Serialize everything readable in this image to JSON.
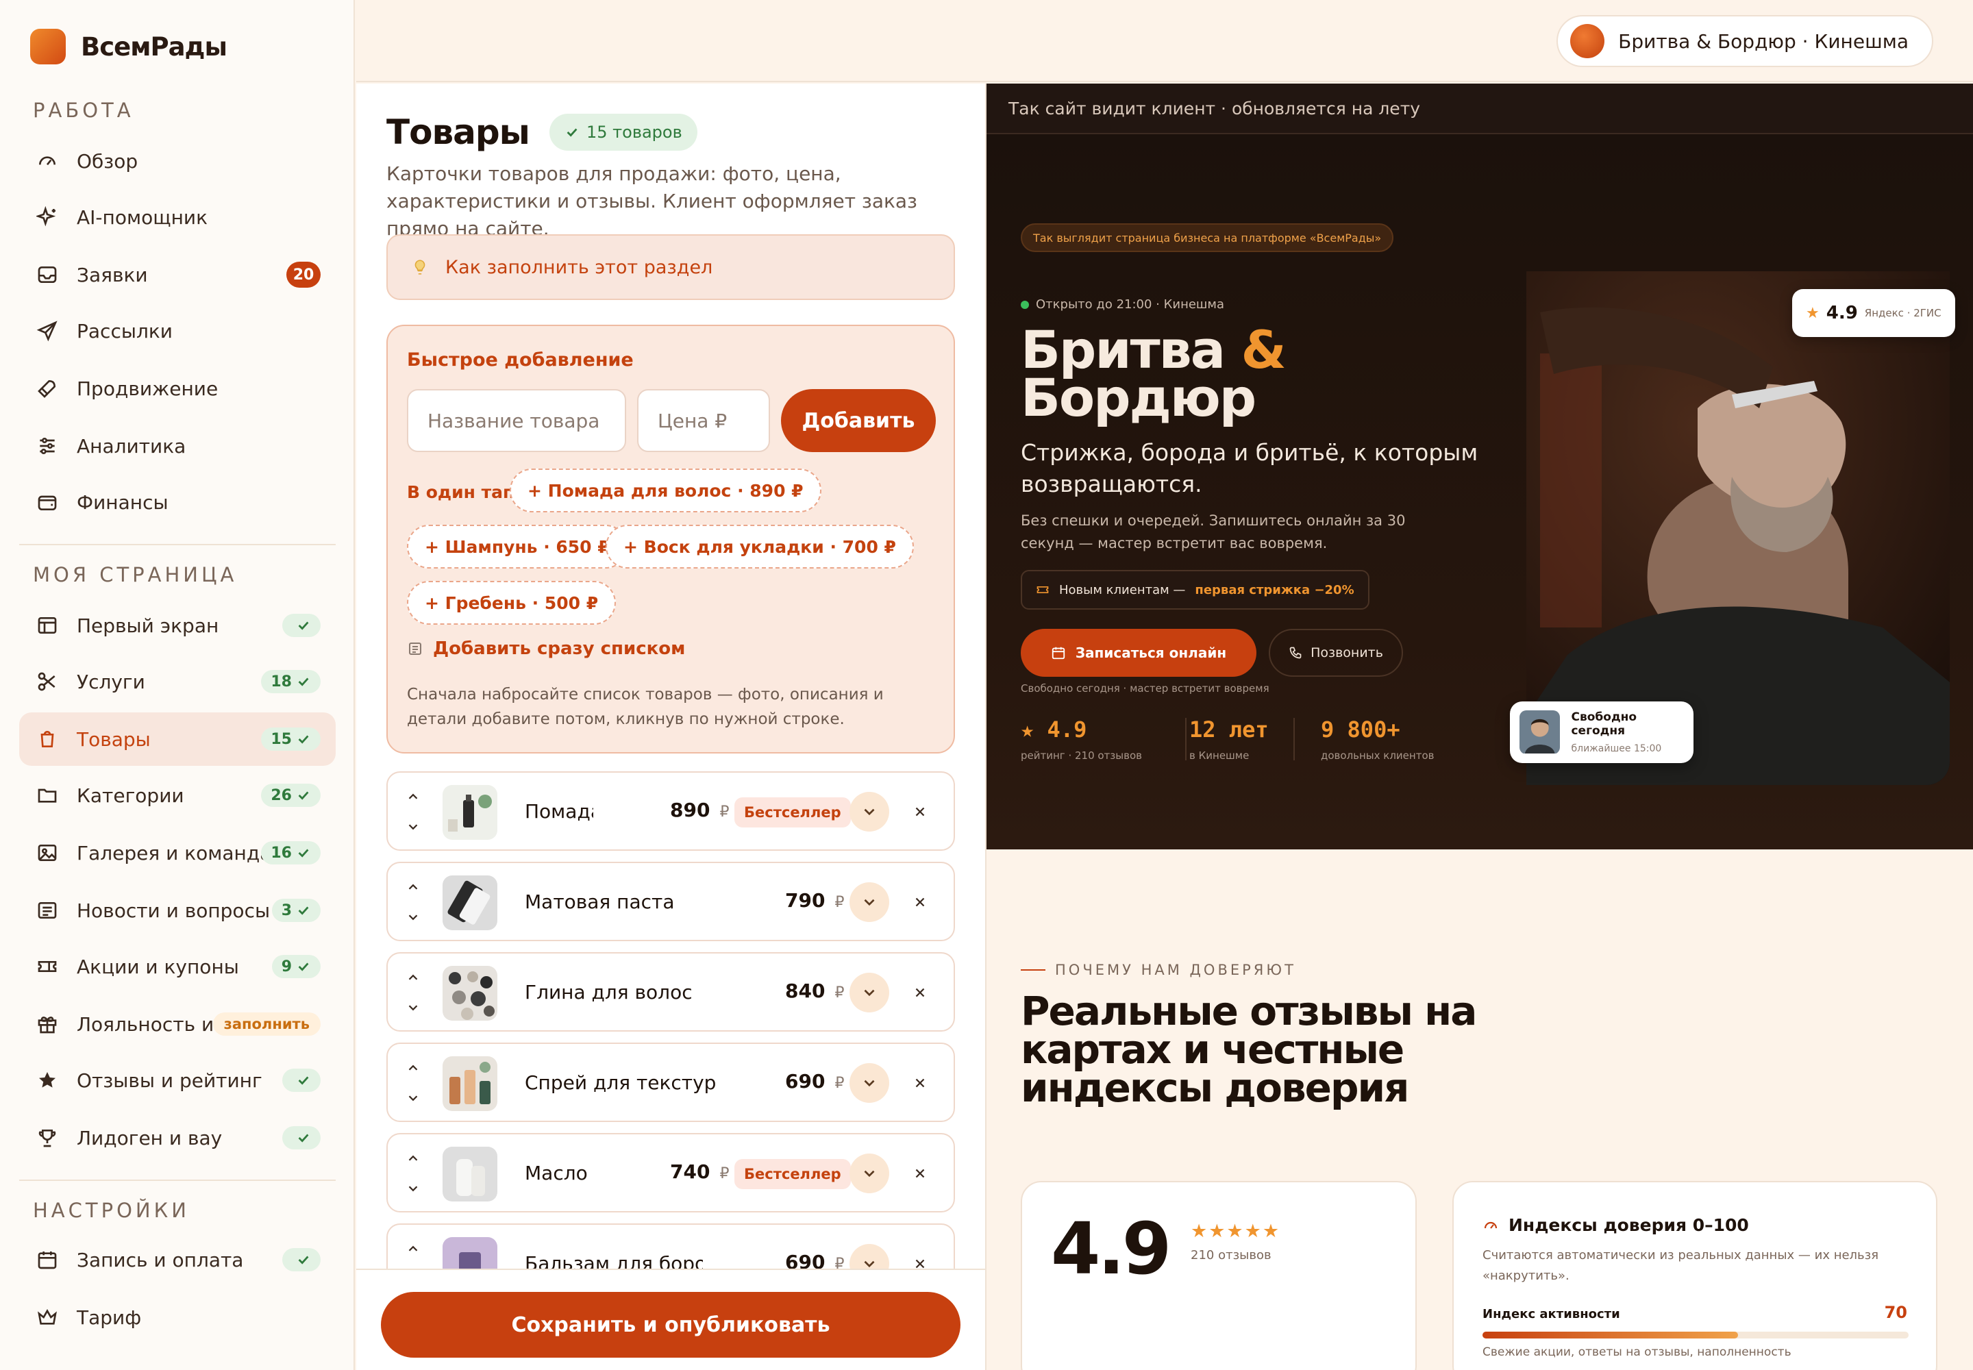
{
  "brand": {
    "name": "ВсемРады"
  },
  "sidebar": {
    "section_work": "Работа",
    "section_page": "Моя страница",
    "section_settings": "Настройки",
    "work_items": [
      {
        "label": "Обзор",
        "icon": "gauge-icon"
      },
      {
        "label": "AI-помощник",
        "icon": "sparkle-icon"
      },
      {
        "label": "Заявки",
        "icon": "inbox-icon",
        "badge": "20"
      },
      {
        "label": "Рассылки",
        "icon": "send-icon"
      },
      {
        "label": "Продвижение",
        "icon": "rocket-icon"
      },
      {
        "label": "Аналитика",
        "icon": "sliders-icon"
      },
      {
        "label": "Финансы",
        "icon": "wallet-icon"
      }
    ],
    "page_items": [
      {
        "label": "Первый экран",
        "icon": "layout-icon",
        "badge": ""
      },
      {
        "label": "Услуги",
        "icon": "scissors-icon",
        "badge": "18"
      },
      {
        "label": "Товары",
        "icon": "bag-icon",
        "badge": "15",
        "active": true
      },
      {
        "label": "Категории",
        "icon": "folder-icon",
        "badge": "26"
      },
      {
        "label": "Галерея и команда",
        "icon": "image-icon",
        "badge": "16"
      },
      {
        "label": "Новости и вопросы",
        "icon": "news-icon",
        "badge": "3"
      },
      {
        "label": "Акции и купоны",
        "icon": "ticket-icon",
        "badge": "9"
      },
      {
        "label": "Лояльность и...",
        "icon": "gift-icon",
        "badge": "заполнить"
      },
      {
        "label": "Отзывы и рейтинг",
        "icon": "star-icon",
        "badge": ""
      },
      {
        "label": "Лидоген и вау",
        "icon": "trophy-icon",
        "badge": ""
      }
    ],
    "settings_items": [
      {
        "label": "Запись и оплата",
        "icon": "calendar-icon",
        "badge": ""
      },
      {
        "label": "Тариф",
        "icon": "crown-icon"
      }
    ]
  },
  "topbar": {
    "business": "Бритва & Бордюр · Кинешма"
  },
  "editor": {
    "title": "Товары",
    "count": "15 товаров",
    "description": "Карточки товаров для продажи: фото, цена, характеристики и отзывы. Клиент оформляет заказ прямо на сайте.",
    "hint": "Как заполнить этот раздел",
    "quick": {
      "title": "Быстрое добавление",
      "name_placeholder": "Название товара",
      "price_placeholder": "Цена ₽",
      "add_label": "Добавить",
      "chips_label": "В один тап:",
      "chips": [
        "+ Помада для волос · 890 ₽",
        "+ Шампунь · 650 ₽",
        "+ Воск для укладки · 700 ₽",
        "+ Гребень · 500 ₽"
      ],
      "list_link": "Добавить сразу списком",
      "note": "Сначала набросайте список товаров — фото, описания и детали добавите потом, кликнув по нужной строке."
    },
    "products": [
      {
        "name": "Помада",
        "price": "890",
        "currency": "₽",
        "badge": "Бестселлер"
      },
      {
        "name": "Матовая паста",
        "price": "790",
        "currency": "₽",
        "badge": ""
      },
      {
        "name": "Глина для волос",
        "price": "840",
        "currency": "₽",
        "badge": ""
      },
      {
        "name": "Спрей для текстур",
        "price": "690",
        "currency": "₽",
        "badge": ""
      },
      {
        "name": "Масло",
        "price": "740",
        "currency": "₽",
        "badge": "Бестселлер"
      },
      {
        "name": "Бальзам для бород",
        "price": "690",
        "currency": "₽",
        "badge": ""
      }
    ],
    "save_label": "Сохранить и опубликовать"
  },
  "preview": {
    "bar_text": "Так сайт видит клиент · обновляется на лету",
    "hero": {
      "tag": "Так выглядит страница бизнеса на платформе «ВсемРады»",
      "open": "Открыто до 21:00 · Кинешма",
      "title_a": "Бритва",
      "title_amp": "&",
      "title_b": "Бордюр",
      "subtitle": "Стрижка, борода и бритьё, к которым возвращаются.",
      "text": "Без спешки и очередей. Запишитесь онлайн за 30 секунд — мастер встретит вас вовремя.",
      "promo_prefix": "Новым клиентам —",
      "promo_bold": "первая стрижка −20%",
      "cta": "Записаться онлайн",
      "call": "Позвонить",
      "cta_note": "Свободно сегодня · мастер встретит вовремя",
      "stats": [
        {
          "value": "★ 4.9",
          "label": "рейтинг · 210 отзывов"
        },
        {
          "value": "12 лет",
          "label": "в Кинешме"
        },
        {
          "value": "9 800+",
          "label": "довольных клиентов"
        }
      ],
      "rating_value": "4.9",
      "rating_source": "Яндекс · 2ГИС",
      "free_title": "Свободно сегодня",
      "free_sub": "ближайшее 15:00"
    },
    "why": {
      "label": "Почему нам доверяют",
      "title": "Реальные отзывы на картах и честные индексы доверия"
    },
    "rating_card": {
      "value": "4.9",
      "stars": "★★★★★",
      "count": "210 отзывов"
    },
    "index_card": {
      "title": "Индексы доверия 0–100",
      "desc": "Считаются автоматически из реальных данных — их нельзя «накрутить».",
      "name": "Индекс активности",
      "value": "70",
      "level": 0.6,
      "note": "Свежие акции, ответы на отзывы, наполненность"
    }
  },
  "colors": {
    "accent": "#c7400f",
    "orange": "#f0952f",
    "dark": "#1b110c"
  }
}
